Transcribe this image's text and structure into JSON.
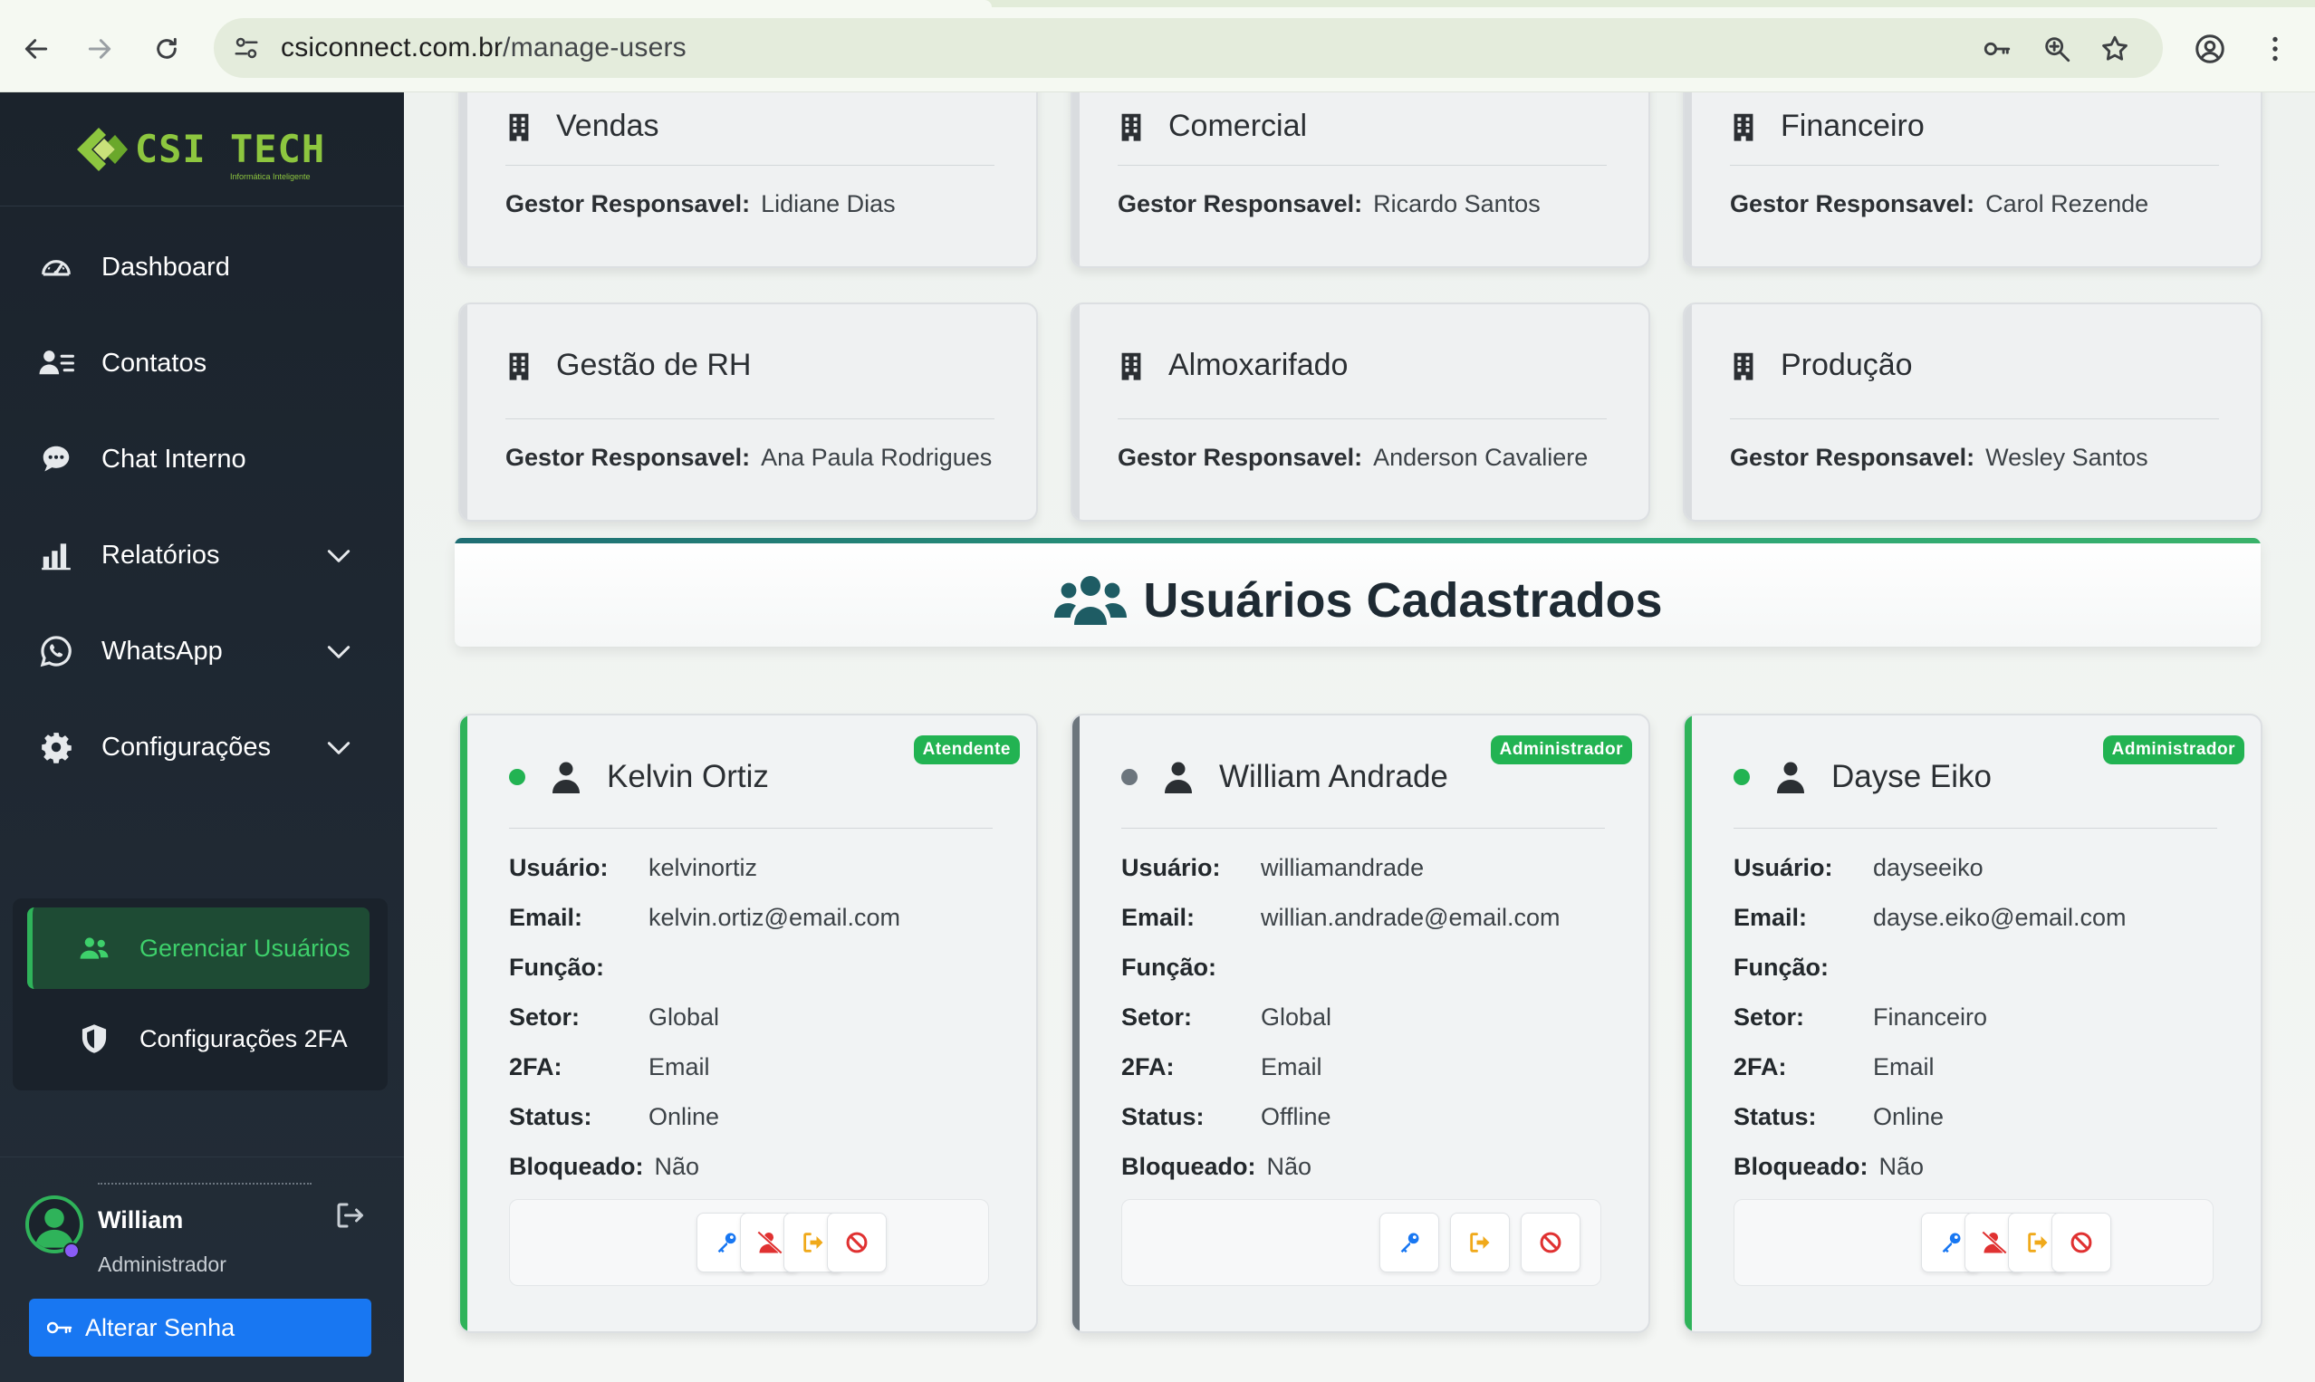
{
  "browser": {
    "url_host": "csiconnect.com.br",
    "url_path": "/manage-users"
  },
  "brand": {
    "name": "CSI TECH",
    "tagline": "Informática  Inteligente",
    "color": "#8dc63f"
  },
  "sidebar": {
    "items": [
      {
        "label": "Dashboard",
        "icon": "gauge-icon"
      },
      {
        "label": "Contatos",
        "icon": "contacts-icon"
      },
      {
        "label": "Chat Interno",
        "icon": "chat-icon"
      },
      {
        "label": "Relatórios",
        "icon": "bar-chart-icon",
        "expandable": true
      },
      {
        "label": "WhatsApp",
        "icon": "whatsapp-icon",
        "expandable": true
      },
      {
        "label": "Configurações",
        "icon": "gear-icon",
        "expandable": true
      }
    ],
    "submenu": [
      {
        "label": "Gerenciar Usuários",
        "icon": "users-icon",
        "active": true
      },
      {
        "label": "Configurações 2FA",
        "icon": "shield-icon",
        "active": false
      }
    ],
    "user": {
      "name": "William",
      "role": "Administrador",
      "change_password_label": "Alterar Senha"
    }
  },
  "sectors": {
    "manager_label": "Gestor Responsavel:",
    "items": [
      {
        "title": "Vendas",
        "manager": "Lidiane Dias"
      },
      {
        "title": "Comercial",
        "manager": "Ricardo Santos"
      },
      {
        "title": "Financeiro",
        "manager": "Carol Rezende"
      },
      {
        "title": "Gestão de RH",
        "manager": "Ana Paula Rodrigues"
      },
      {
        "title": "Almoxarifado",
        "manager": "Anderson Cavaliere"
      },
      {
        "title": "Produção",
        "manager": "Wesley Santos"
      }
    ]
  },
  "users_section": {
    "title": "Usuários Cadastrados"
  },
  "user_fields": {
    "username": "Usuário:",
    "email": "Email:",
    "function": "Função:",
    "sector": "Setor:",
    "twofa": "2FA:",
    "status": "Status:",
    "blocked": "Bloqueado:"
  },
  "users": [
    {
      "name": "Kelvin Ortiz",
      "role_badge": "Atendente",
      "username": "kelvinortiz",
      "email": "kelvin.ortiz@email.com",
      "function": "",
      "sector": "Global",
      "twofa": "Email",
      "status": "Online",
      "blocked": "Não",
      "presence_color": "#22b352",
      "accent": "#2fb35a",
      "actions": [
        "key-icon",
        "user-block-icon",
        "logout-icon",
        "ban-icon"
      ]
    },
    {
      "name": "William Andrade",
      "role_badge": "Administrador",
      "username": "williamandrade",
      "email": "willian.andrade@email.com",
      "function": "",
      "sector": "Global",
      "twofa": "Email",
      "status": "Offline",
      "blocked": "Não",
      "presence_color": "#6c757d",
      "accent": "#6c757d",
      "actions": [
        "key-icon",
        "logout-icon",
        "ban-icon"
      ]
    },
    {
      "name": "Dayse Eiko",
      "role_badge": "Administrador",
      "username": "dayseeiko",
      "email": "dayse.eiko@email.com",
      "function": "",
      "sector": "Financeiro",
      "twofa": "Email",
      "status": "Online",
      "blocked": "Não",
      "presence_color": "#22b352",
      "accent": "#2fb35a",
      "actions": [
        "key-icon",
        "user-block-icon",
        "logout-icon",
        "ban-icon"
      ]
    }
  ],
  "colors": {
    "sidebar_bg": "#1e2731",
    "active_green": "#2fb35a",
    "primary_blue": "#1877f2",
    "badge_green": "#22b352"
  }
}
